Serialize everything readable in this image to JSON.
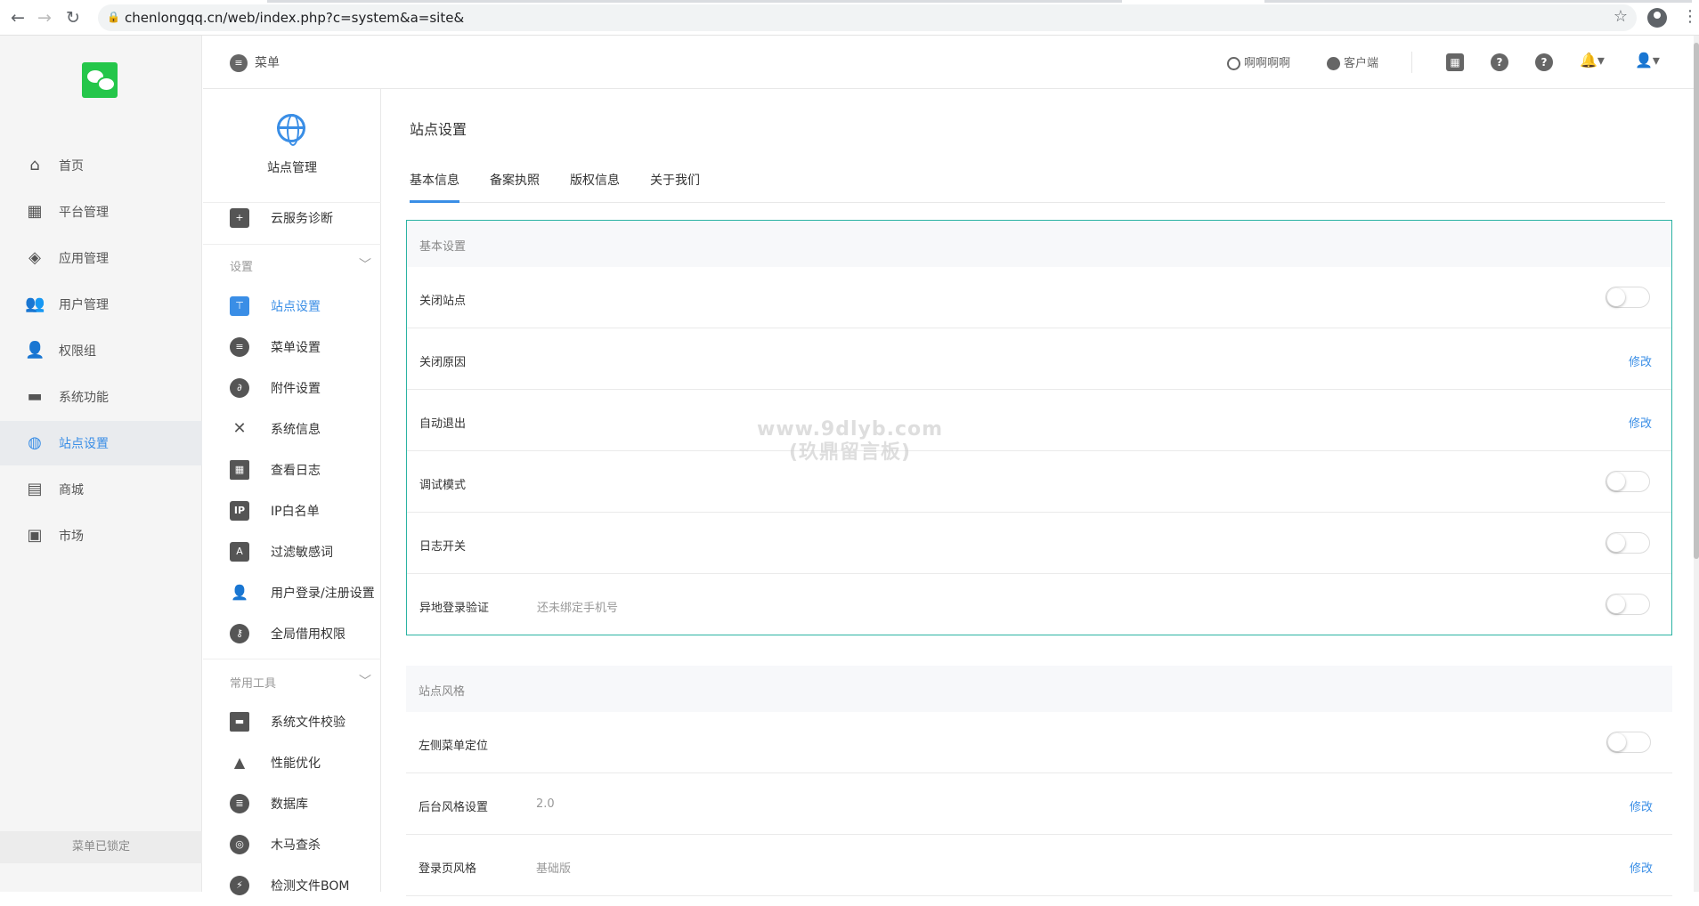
{
  "browser": {
    "url": "chenlongqq.cn/web/index.php?c=system&a=site&"
  },
  "left_nav": {
    "items": [
      {
        "label": "首页",
        "icon": "home-icon"
      },
      {
        "label": "平台管理",
        "icon": "grid-icon"
      },
      {
        "label": "应用管理",
        "icon": "cube-icon"
      },
      {
        "label": "用户管理",
        "icon": "users-icon"
      },
      {
        "label": "权限组",
        "icon": "user-lock-icon"
      },
      {
        "label": "系统功能",
        "icon": "monitor-icon"
      },
      {
        "label": "站点设置",
        "icon": "globe-icon"
      },
      {
        "label": "商城",
        "icon": "store-icon"
      },
      {
        "label": "市场",
        "icon": "bag-icon"
      }
    ],
    "active": "站点设置",
    "locked_label": "菜单已锁定"
  },
  "topbar": {
    "menu_label": "菜单",
    "link1": "啊啊啊啊",
    "link2": "客户端"
  },
  "sub_nav": {
    "title": "站点管理",
    "cloud_item": "云服务诊断",
    "group1": "设置",
    "group1_items": [
      "站点设置",
      "菜单设置",
      "附件设置",
      "系统信息",
      "查看日志",
      "IP白名单",
      "过滤敏感词",
      "用户登录/注册设置",
      "全局借用权限"
    ],
    "group2": "常用工具",
    "group2_items": [
      "系统文件校验",
      "性能优化",
      "数据库",
      "木马查杀",
      "检测文件BOM"
    ],
    "ip_badge": "IP"
  },
  "main": {
    "title": "站点设置",
    "tabs": [
      "基本信息",
      "备案执照",
      "版权信息",
      "关于我们"
    ],
    "basic_section": "基本设置",
    "basic_rows": [
      {
        "label": "关闭站点",
        "type": "toggle",
        "on": false
      },
      {
        "label": "关闭原因",
        "type": "edit",
        "action": "修改"
      },
      {
        "label": "自动退出",
        "type": "edit",
        "action": "修改"
      },
      {
        "label": "调试模式",
        "type": "toggle",
        "on": false
      },
      {
        "label": "日志开关",
        "type": "toggle",
        "on": false
      },
      {
        "label": "异地登录验证",
        "value": "还未绑定手机号",
        "type": "toggle",
        "on": false
      }
    ],
    "style_section": "站点风格",
    "style_rows": [
      {
        "label": "左侧菜单定位",
        "type": "toggle",
        "on": false
      },
      {
        "label": "后台风格设置",
        "value": "2.0",
        "type": "edit",
        "action": "修改"
      },
      {
        "label": "登录页风格",
        "value": "基础版",
        "type": "edit",
        "action": "修改"
      }
    ]
  },
  "watermark": {
    "line1": "www.9dlyb.com",
    "line2": "(玖鼎留言板)"
  },
  "colors": {
    "accent": "#3a8ee6",
    "selected_border": "#2bb3a3"
  }
}
